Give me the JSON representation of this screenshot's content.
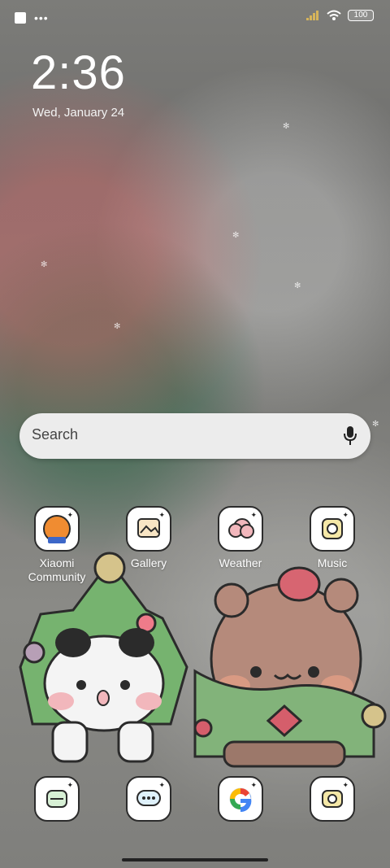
{
  "status": {
    "battery": "100"
  },
  "clock": {
    "time": "2:36",
    "date": "Wed, January 24"
  },
  "search": {
    "placeholder": "Search"
  },
  "apps_row1": [
    {
      "label": "Xiaomi\nCommunity",
      "icon": "xiaomi-community-icon"
    },
    {
      "label": "Gallery",
      "icon": "gallery-icon"
    },
    {
      "label": "Weather",
      "icon": "weather-icon"
    },
    {
      "label": "Music",
      "icon": "music-icon"
    }
  ],
  "dock_icons": [
    "security-icon",
    "messages-icon",
    "google-icon",
    "camera-icon"
  ]
}
